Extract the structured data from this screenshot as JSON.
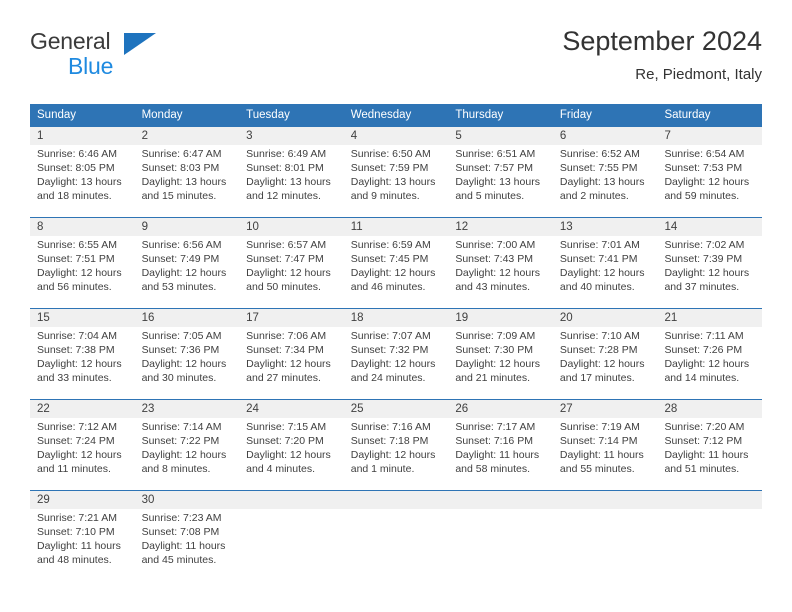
{
  "brand": {
    "name_part1": "General",
    "name_part2": "Blue",
    "triangle_icon": "blue-triangle-icon",
    "accent_color": "#1e73be",
    "blue_text_color": "#1f8ae0"
  },
  "header": {
    "title": "September 2024",
    "subtitle": "Re, Piedmont, Italy"
  },
  "calendar": {
    "header_bg_color": "#2e74b5",
    "daynum_band_color": "#f0f0f0",
    "weekday_headers": [
      "Sunday",
      "Monday",
      "Tuesday",
      "Wednesday",
      "Thursday",
      "Friday",
      "Saturday"
    ],
    "weeks": [
      [
        {
          "day": "1",
          "sunrise": "Sunrise: 6:46 AM",
          "sunset": "Sunset: 8:05 PM",
          "daylight_1": "Daylight: 13 hours",
          "daylight_2": "and 18 minutes."
        },
        {
          "day": "2",
          "sunrise": "Sunrise: 6:47 AM",
          "sunset": "Sunset: 8:03 PM",
          "daylight_1": "Daylight: 13 hours",
          "daylight_2": "and 15 minutes."
        },
        {
          "day": "3",
          "sunrise": "Sunrise: 6:49 AM",
          "sunset": "Sunset: 8:01 PM",
          "daylight_1": "Daylight: 13 hours",
          "daylight_2": "and 12 minutes."
        },
        {
          "day": "4",
          "sunrise": "Sunrise: 6:50 AM",
          "sunset": "Sunset: 7:59 PM",
          "daylight_1": "Daylight: 13 hours",
          "daylight_2": "and 9 minutes."
        },
        {
          "day": "5",
          "sunrise": "Sunrise: 6:51 AM",
          "sunset": "Sunset: 7:57 PM",
          "daylight_1": "Daylight: 13 hours",
          "daylight_2": "and 5 minutes."
        },
        {
          "day": "6",
          "sunrise": "Sunrise: 6:52 AM",
          "sunset": "Sunset: 7:55 PM",
          "daylight_1": "Daylight: 13 hours",
          "daylight_2": "and 2 minutes."
        },
        {
          "day": "7",
          "sunrise": "Sunrise: 6:54 AM",
          "sunset": "Sunset: 7:53 PM",
          "daylight_1": "Daylight: 12 hours",
          "daylight_2": "and 59 minutes."
        }
      ],
      [
        {
          "day": "8",
          "sunrise": "Sunrise: 6:55 AM",
          "sunset": "Sunset: 7:51 PM",
          "daylight_1": "Daylight: 12 hours",
          "daylight_2": "and 56 minutes."
        },
        {
          "day": "9",
          "sunrise": "Sunrise: 6:56 AM",
          "sunset": "Sunset: 7:49 PM",
          "daylight_1": "Daylight: 12 hours",
          "daylight_2": "and 53 minutes."
        },
        {
          "day": "10",
          "sunrise": "Sunrise: 6:57 AM",
          "sunset": "Sunset: 7:47 PM",
          "daylight_1": "Daylight: 12 hours",
          "daylight_2": "and 50 minutes."
        },
        {
          "day": "11",
          "sunrise": "Sunrise: 6:59 AM",
          "sunset": "Sunset: 7:45 PM",
          "daylight_1": "Daylight: 12 hours",
          "daylight_2": "and 46 minutes."
        },
        {
          "day": "12",
          "sunrise": "Sunrise: 7:00 AM",
          "sunset": "Sunset: 7:43 PM",
          "daylight_1": "Daylight: 12 hours",
          "daylight_2": "and 43 minutes."
        },
        {
          "day": "13",
          "sunrise": "Sunrise: 7:01 AM",
          "sunset": "Sunset: 7:41 PM",
          "daylight_1": "Daylight: 12 hours",
          "daylight_2": "and 40 minutes."
        },
        {
          "day": "14",
          "sunrise": "Sunrise: 7:02 AM",
          "sunset": "Sunset: 7:39 PM",
          "daylight_1": "Daylight: 12 hours",
          "daylight_2": "and 37 minutes."
        }
      ],
      [
        {
          "day": "15",
          "sunrise": "Sunrise: 7:04 AM",
          "sunset": "Sunset: 7:38 PM",
          "daylight_1": "Daylight: 12 hours",
          "daylight_2": "and 33 minutes."
        },
        {
          "day": "16",
          "sunrise": "Sunrise: 7:05 AM",
          "sunset": "Sunset: 7:36 PM",
          "daylight_1": "Daylight: 12 hours",
          "daylight_2": "and 30 minutes."
        },
        {
          "day": "17",
          "sunrise": "Sunrise: 7:06 AM",
          "sunset": "Sunset: 7:34 PM",
          "daylight_1": "Daylight: 12 hours",
          "daylight_2": "and 27 minutes."
        },
        {
          "day": "18",
          "sunrise": "Sunrise: 7:07 AM",
          "sunset": "Sunset: 7:32 PM",
          "daylight_1": "Daylight: 12 hours",
          "daylight_2": "and 24 minutes."
        },
        {
          "day": "19",
          "sunrise": "Sunrise: 7:09 AM",
          "sunset": "Sunset: 7:30 PM",
          "daylight_1": "Daylight: 12 hours",
          "daylight_2": "and 21 minutes."
        },
        {
          "day": "20",
          "sunrise": "Sunrise: 7:10 AM",
          "sunset": "Sunset: 7:28 PM",
          "daylight_1": "Daylight: 12 hours",
          "daylight_2": "and 17 minutes."
        },
        {
          "day": "21",
          "sunrise": "Sunrise: 7:11 AM",
          "sunset": "Sunset: 7:26 PM",
          "daylight_1": "Daylight: 12 hours",
          "daylight_2": "and 14 minutes."
        }
      ],
      [
        {
          "day": "22",
          "sunrise": "Sunrise: 7:12 AM",
          "sunset": "Sunset: 7:24 PM",
          "daylight_1": "Daylight: 12 hours",
          "daylight_2": "and 11 minutes."
        },
        {
          "day": "23",
          "sunrise": "Sunrise: 7:14 AM",
          "sunset": "Sunset: 7:22 PM",
          "daylight_1": "Daylight: 12 hours",
          "daylight_2": "and 8 minutes."
        },
        {
          "day": "24",
          "sunrise": "Sunrise: 7:15 AM",
          "sunset": "Sunset: 7:20 PM",
          "daylight_1": "Daylight: 12 hours",
          "daylight_2": "and 4 minutes."
        },
        {
          "day": "25",
          "sunrise": "Sunrise: 7:16 AM",
          "sunset": "Sunset: 7:18 PM",
          "daylight_1": "Daylight: 12 hours",
          "daylight_2": "and 1 minute."
        },
        {
          "day": "26",
          "sunrise": "Sunrise: 7:17 AM",
          "sunset": "Sunset: 7:16 PM",
          "daylight_1": "Daylight: 11 hours",
          "daylight_2": "and 58 minutes."
        },
        {
          "day": "27",
          "sunrise": "Sunrise: 7:19 AM",
          "sunset": "Sunset: 7:14 PM",
          "daylight_1": "Daylight: 11 hours",
          "daylight_2": "and 55 minutes."
        },
        {
          "day": "28",
          "sunrise": "Sunrise: 7:20 AM",
          "sunset": "Sunset: 7:12 PM",
          "daylight_1": "Daylight: 11 hours",
          "daylight_2": "and 51 minutes."
        }
      ],
      [
        {
          "day": "29",
          "sunrise": "Sunrise: 7:21 AM",
          "sunset": "Sunset: 7:10 PM",
          "daylight_1": "Daylight: 11 hours",
          "daylight_2": "and 48 minutes."
        },
        {
          "day": "30",
          "sunrise": "Sunrise: 7:23 AM",
          "sunset": "Sunset: 7:08 PM",
          "daylight_1": "Daylight: 11 hours",
          "daylight_2": "and 45 minutes."
        },
        {
          "day": "",
          "sunrise": "",
          "sunset": "",
          "daylight_1": "",
          "daylight_2": ""
        },
        {
          "day": "",
          "sunrise": "",
          "sunset": "",
          "daylight_1": "",
          "daylight_2": ""
        },
        {
          "day": "",
          "sunrise": "",
          "sunset": "",
          "daylight_1": "",
          "daylight_2": ""
        },
        {
          "day": "",
          "sunrise": "",
          "sunset": "",
          "daylight_1": "",
          "daylight_2": ""
        },
        {
          "day": "",
          "sunrise": "",
          "sunset": "",
          "daylight_1": "",
          "daylight_2": ""
        }
      ]
    ]
  }
}
